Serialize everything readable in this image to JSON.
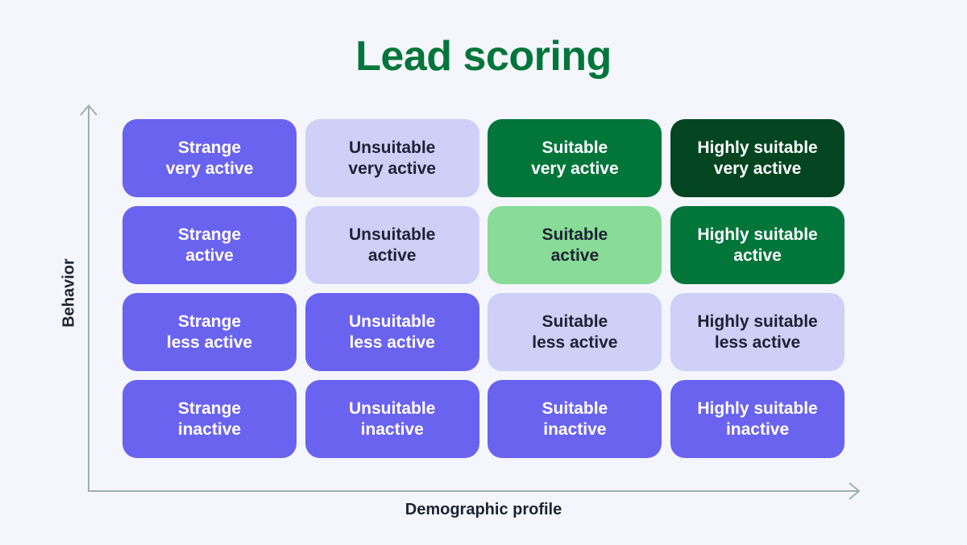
{
  "title": "Lead scoring",
  "colors": {
    "title": "#02763a",
    "axis": "#9fb0a8",
    "background": "#f5f6fd"
  },
  "axes": {
    "y_label": "Behavior",
    "x_label": "Demographic profile"
  },
  "styles": {
    "purple": {
      "bg": "#6a63f0",
      "fg": "#ffffff"
    },
    "lavender": {
      "bg": "#cfcff7",
      "fg": "#1c2333"
    },
    "green": {
      "bg": "#02763a",
      "fg": "#ffffff"
    },
    "light-green": {
      "bg": "#88dc98",
      "fg": "#1c2333"
    },
    "dark-green": {
      "bg": "#034520",
      "fg": "#ffffff"
    }
  },
  "columns": [
    "Strange",
    "Unsuitable",
    "Suitable",
    "Highly suitable"
  ],
  "rows": [
    "very active",
    "active",
    "less active",
    "inactive"
  ],
  "cells": [
    [
      {
        "line1": "Strange",
        "line2": "very active",
        "style": "purple"
      },
      {
        "line1": "Unsuitable",
        "line2": "very active",
        "style": "lavender"
      },
      {
        "line1": "Suitable",
        "line2": "very active",
        "style": "green"
      },
      {
        "line1": "Highly suitable",
        "line2": "very active",
        "style": "dark-green"
      }
    ],
    [
      {
        "line1": "Strange",
        "line2": "active",
        "style": "purple"
      },
      {
        "line1": "Unsuitable",
        "line2": "active",
        "style": "lavender"
      },
      {
        "line1": "Suitable",
        "line2": "active",
        "style": "light-green"
      },
      {
        "line1": "Highly suitable",
        "line2": "active",
        "style": "green"
      }
    ],
    [
      {
        "line1": "Strange",
        "line2": "less active",
        "style": "purple"
      },
      {
        "line1": "Unsuitable",
        "line2": "less active",
        "style": "purple"
      },
      {
        "line1": "Suitable",
        "line2": "less active",
        "style": "lavender"
      },
      {
        "line1": "Highly suitable",
        "line2": "less active",
        "style": "lavender"
      }
    ],
    [
      {
        "line1": "Strange",
        "line2": "inactive",
        "style": "purple"
      },
      {
        "line1": "Unsuitable",
        "line2": "inactive",
        "style": "purple"
      },
      {
        "line1": "Suitable",
        "line2": "inactive",
        "style": "purple"
      },
      {
        "line1": "Highly suitable",
        "line2": "inactive",
        "style": "purple"
      }
    ]
  ]
}
